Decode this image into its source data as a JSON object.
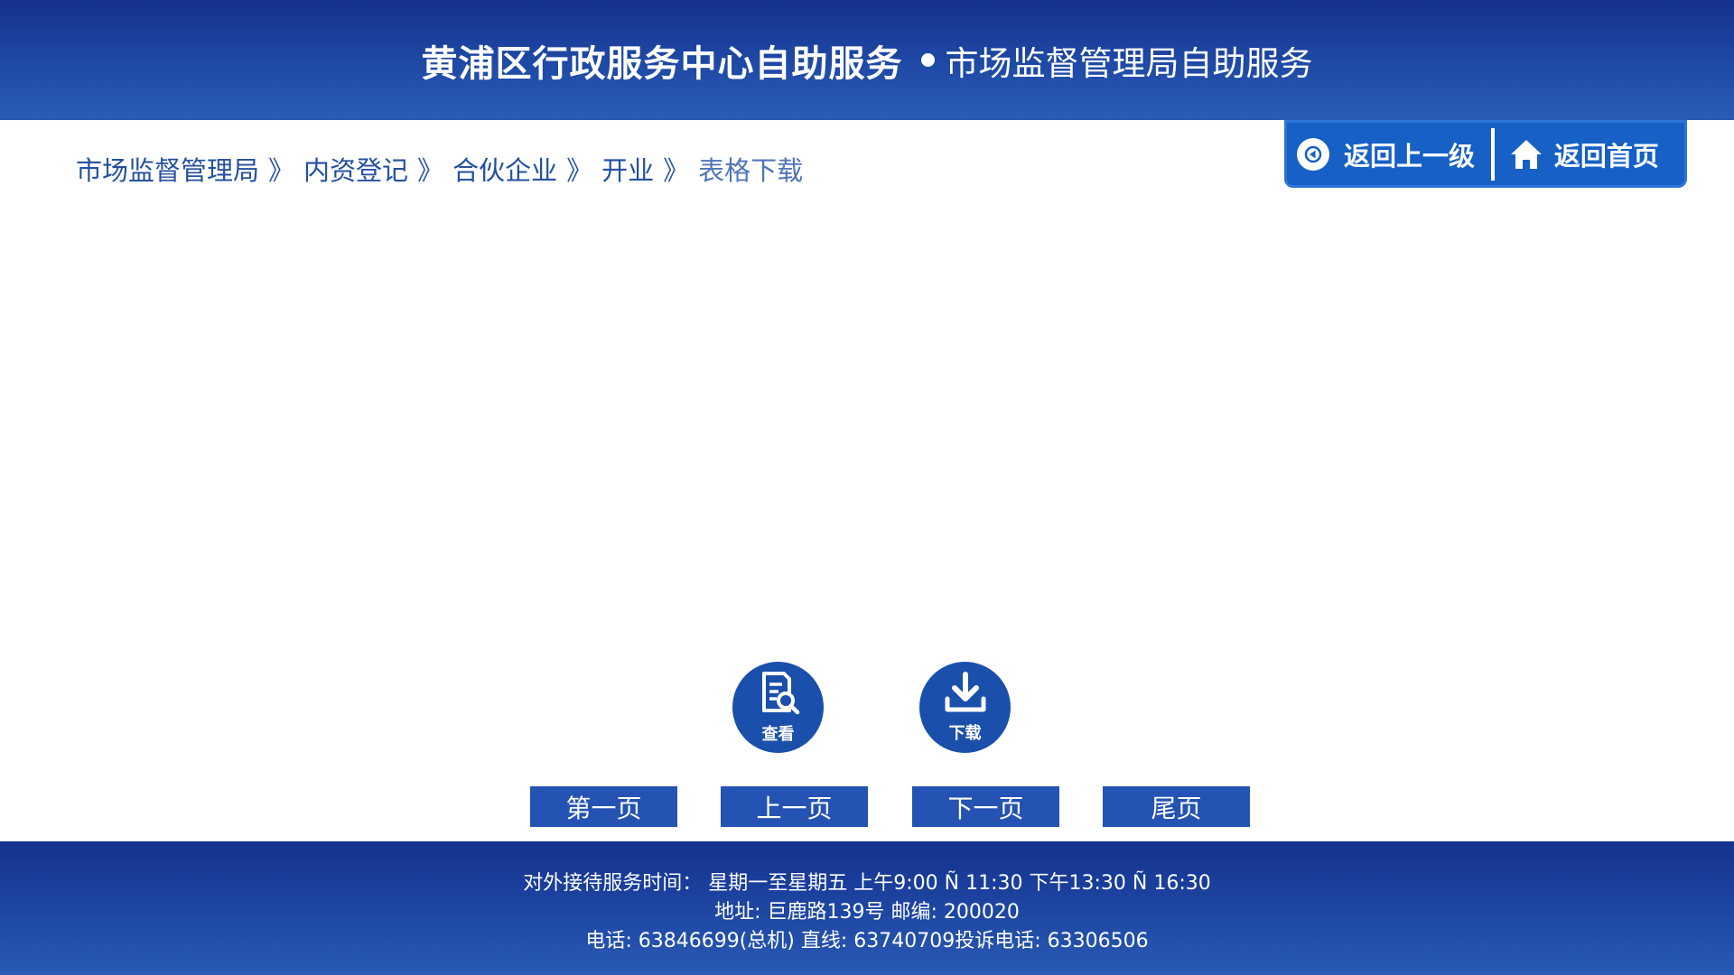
{
  "header": {
    "title_main": "黄浦区行政服务中心自助服务",
    "title_sub": "市场监督管理局自助服务"
  },
  "breadcrumb": {
    "items": [
      "市场监督管理局",
      "内资登记",
      "合伙企业",
      "开业",
      "表格下载"
    ],
    "separator": "》"
  },
  "nav": {
    "back_label": "返回上一级",
    "home_label": "返回首页",
    "back_icon": "back-circle-icon",
    "home_icon": "home-icon"
  },
  "actions": {
    "view_label": "查看",
    "download_label": "下载",
    "view_icon": "document-search-icon",
    "download_icon": "download-icon"
  },
  "pager": {
    "first": "第一页",
    "prev": "上一页",
    "next": "下一页",
    "last": "尾页"
  },
  "footer": {
    "hours": "对外接待服务时间： 星期一至星期五 上午9:00 Ñ 11:30 下午13:30 Ñ 16:30",
    "address": "地址: 巨鹿路139号 邮编: 200020",
    "phone": "电话: 63846699(总机) 直线: 63740709投诉电话: 63306506"
  },
  "colors": {
    "header_bg": "#1f4aa6",
    "nav_bg": "#1660c6",
    "button_bg": "#2553b3",
    "action_bg": "#1a4fab",
    "breadcrumb_text": "#2450a0"
  }
}
